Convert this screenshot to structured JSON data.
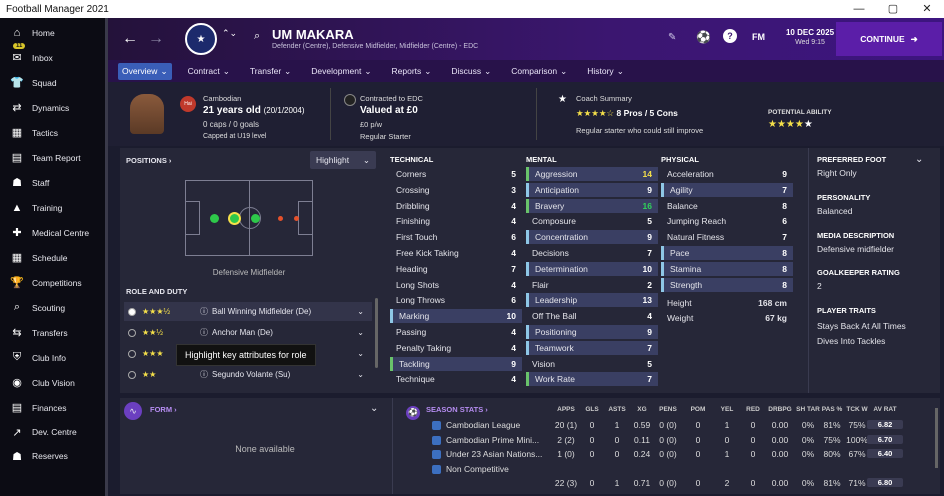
{
  "window": {
    "title": "Football Manager 2021",
    "min": "—",
    "max": "▢",
    "close": "✕"
  },
  "sidebar": {
    "items": [
      {
        "label": "Home",
        "icon": "⌂"
      },
      {
        "label": "Inbox",
        "icon": "✉",
        "badge": "11"
      },
      {
        "label": "Squad",
        "icon": "👕"
      },
      {
        "label": "Dynamics",
        "icon": "⇄"
      },
      {
        "label": "Tactics",
        "icon": "▦"
      },
      {
        "label": "Team Report",
        "icon": "▤"
      },
      {
        "label": "Staff",
        "icon": "☗"
      },
      {
        "label": "Training",
        "icon": "▲"
      },
      {
        "label": "Medical Centre",
        "icon": "✚"
      },
      {
        "label": "Schedule",
        "icon": "▦"
      },
      {
        "label": "Competitions",
        "icon": "🏆"
      },
      {
        "label": "Scouting",
        "icon": "⌕"
      },
      {
        "label": "Transfers",
        "icon": "⇆"
      },
      {
        "label": "Club Info",
        "icon": "⛨"
      },
      {
        "label": "Club Vision",
        "icon": "◉"
      },
      {
        "label": "Finances",
        "icon": "▤"
      },
      {
        "label": "Dev. Centre",
        "icon": "↗"
      },
      {
        "label": "Reserves",
        "icon": "☗"
      }
    ]
  },
  "top": {
    "name": "UM MAKARA",
    "positions": "Defender (Centre), Defensive Midfielder, Midfielder (Centre) - EDC",
    "date": "10 DEC 2025",
    "time": "Wed 9:15",
    "fm": "FM",
    "continue": "CONTINUE"
  },
  "tabs": [
    "Overview",
    "Contract",
    "Transfer",
    "Development",
    "Reports",
    "Discuss",
    "Comparison",
    "History"
  ],
  "bio": {
    "nation": "Cambodian",
    "age": "21 years old",
    "dob": "(20/1/2004)",
    "caps": "0 caps / 0 goals",
    "capped": "Capped at U19 level",
    "flag": "Hai",
    "contract_label": "Contracted to EDC",
    "value": "Valued at £0",
    "wage": "£0 p/w",
    "status": "Regular Starter",
    "coach_label": "Coach Summary",
    "pros": "8 Pros / 5 Cons",
    "coach_text": "Regular starter who could still improve",
    "pa_label": "POTENTIAL ABILITY"
  },
  "positions": {
    "header": "POSITIONS ›",
    "highlight": "Highlight",
    "role_label": "Defensive Midfielder",
    "role_duty": "ROLE AND DUTY",
    "roles": [
      "Ball Winning Midfielder (De)",
      "Anchor Man (De)",
      "",
      "Segundo Volante (Su)"
    ],
    "tooltip": "Highlight key attributes for role"
  },
  "technical": {
    "header": "TECHNICAL",
    "rows": [
      [
        "Corners",
        "5"
      ],
      [
        "Crossing",
        "3"
      ],
      [
        "Dribbling",
        "4"
      ],
      [
        "Finishing",
        "4"
      ],
      [
        "First Touch",
        "6"
      ],
      [
        "Free Kick Taking",
        "4"
      ],
      [
        "Heading",
        "7"
      ],
      [
        "Long Shots",
        "4"
      ],
      [
        "Long Throws",
        "6"
      ],
      [
        "Marking",
        "10"
      ],
      [
        "Passing",
        "4"
      ],
      [
        "Penalty Taking",
        "4"
      ],
      [
        "Tackling",
        "9"
      ],
      [
        "Technique",
        "4"
      ]
    ]
  },
  "mental": {
    "header": "MENTAL",
    "rows": [
      [
        "Aggression",
        "14"
      ],
      [
        "Anticipation",
        "9"
      ],
      [
        "Bravery",
        "16"
      ],
      [
        "Composure",
        "5"
      ],
      [
        "Concentration",
        "9"
      ],
      [
        "Decisions",
        "7"
      ],
      [
        "Determination",
        "10"
      ],
      [
        "Flair",
        "2"
      ],
      [
        "Leadership",
        "13"
      ],
      [
        "Off The Ball",
        "4"
      ],
      [
        "Positioning",
        "9"
      ],
      [
        "Teamwork",
        "7"
      ],
      [
        "Vision",
        "5"
      ],
      [
        "Work Rate",
        "7"
      ]
    ]
  },
  "physical": {
    "header": "PHYSICAL",
    "rows": [
      [
        "Acceleration",
        "9"
      ],
      [
        "Agility",
        "7"
      ],
      [
        "Balance",
        "8"
      ],
      [
        "Jumping Reach",
        "6"
      ],
      [
        "Natural Fitness",
        "7"
      ],
      [
        "Pace",
        "8"
      ],
      [
        "Stamina",
        "8"
      ],
      [
        "Strength",
        "8"
      ]
    ],
    "height_l": "Height",
    "height": "168 cm",
    "weight_l": "Weight",
    "weight": "67 kg"
  },
  "info": {
    "foot_h": "PREFERRED FOOT",
    "foot": "Right Only",
    "pers_h": "PERSONALITY",
    "pers": "Balanced",
    "media_h": "MEDIA DESCRIPTION",
    "media": "Defensive midfielder",
    "gk_h": "GOALKEEPER RATING",
    "gk": "2",
    "traits_h": "PLAYER TRAITS",
    "traits": [
      "Stays Back At All Times",
      "Dives Into Tackles"
    ]
  },
  "form": {
    "header": "FORM ›",
    "none": "None available"
  },
  "season": {
    "header": "SEASON STATS ›",
    "cols": [
      "APPS",
      "GLS",
      "ASTS",
      "XG",
      "PENS",
      "POM",
      "YEL",
      "RED",
      "DRBPG",
      "SH TAR",
      "PAS %",
      "TCK W",
      "AV RAT"
    ],
    "rows": [
      [
        "Cambodian League",
        "20 (1)",
        "0",
        "1",
        "0.59",
        "0 (0)",
        "0",
        "1",
        "0",
        "0.00",
        "0%",
        "81%",
        "75%",
        "6.82"
      ],
      [
        "Cambodian Prime Mini...",
        "2 (2)",
        "0",
        "0",
        "0.11",
        "0 (0)",
        "0",
        "0",
        "0",
        "0.00",
        "0%",
        "75%",
        "100%",
        "6.70"
      ],
      [
        "Under 23 Asian Nations...",
        "1 (0)",
        "0",
        "0",
        "0.24",
        "0 (0)",
        "0",
        "1",
        "0",
        "0.00",
        "0%",
        "80%",
        "67%",
        "6.40"
      ],
      [
        "Non Competitive",
        "",
        "",
        "",
        "",
        "",
        "",
        "",
        "",
        "",
        "",
        "",
        "",
        ""
      ],
      [
        "",
        "22 (3)",
        "0",
        "1",
        "0.71",
        "0 (0)",
        "0",
        "2",
        "0",
        "0.00",
        "0%",
        "81%",
        "71%",
        "6.80"
      ]
    ]
  }
}
